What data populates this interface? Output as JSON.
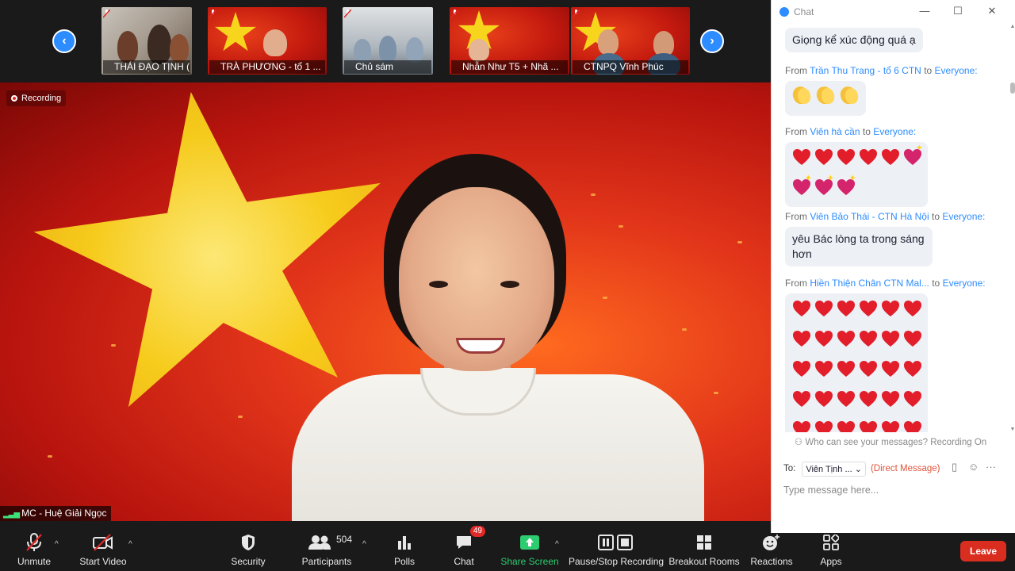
{
  "thumbnails": [
    {
      "name": "THÁI ĐẠO TỊNH (Phật..."
    },
    {
      "name": "TRÀ PHƯƠNG - tổ 1 ..."
    },
    {
      "name": "Chủ sám"
    },
    {
      "name": "Nhẫn Như T5 + Nhã ..."
    },
    {
      "name": "CTNPQ Vĩnh Phúc"
    }
  ],
  "recording_label": "Recording",
  "active_speaker": "MC - Huệ Giải Ngọc",
  "toolbar": {
    "unmute": "Unmute",
    "start_video": "Start Video",
    "security": "Security",
    "participants": "Participants",
    "participants_count": "504",
    "polls": "Polls",
    "chat": "Chat",
    "chat_badge": "49",
    "share_screen": "Share Screen",
    "pause_stop_recording": "Pause/Stop Recording",
    "breakout_rooms": "Breakout Rooms",
    "reactions": "Reactions",
    "apps": "Apps",
    "leave": "Leave"
  },
  "chat": {
    "title": "Chat",
    "messages": [
      {
        "from": "",
        "to": "",
        "text": "Giọng kể xúc động quá ạ"
      },
      {
        "from": "Trần Thu Trang - tổ 6 CTN",
        "to": "Everyone:",
        "emoji": "clap x3"
      },
      {
        "from": "Viên hà cần",
        "to": "Everyone:",
        "emoji": "red heart x5, sparkling heart x4"
      },
      {
        "from": "Viên Bảo Thái - CTN Hà Nội",
        "to": "Everyone:",
        "text": "yêu Bác lòng ta trong sáng hơn"
      },
      {
        "from": "Hiền Thiện Chân CTN Mal...",
        "to": "Everyone:",
        "emoji": "red heart x30"
      }
    ],
    "from_word": "From",
    "to_word": "to",
    "who_can_see": "Who can see your messages? Recording On",
    "to_label": "To:",
    "recipient": "Viên Tịnh ...",
    "direct_message": "(Direct Message)",
    "input_placeholder": "Type message here..."
  },
  "colors": {
    "accent": "#2d8cff",
    "leave": "#d92d20",
    "share_green": "#2ecc71",
    "badge_red": "#e02828"
  }
}
